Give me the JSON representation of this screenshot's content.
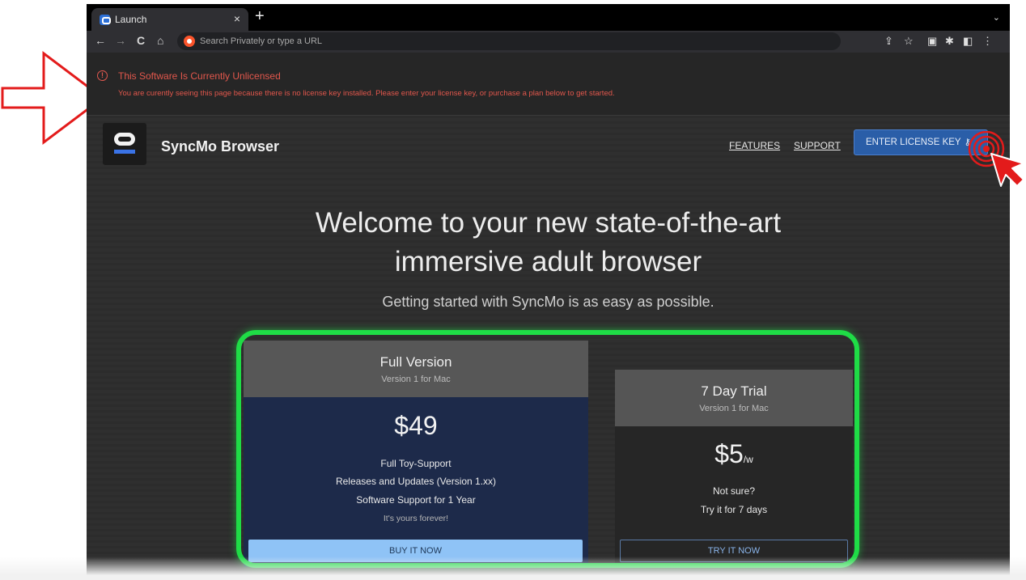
{
  "browser": {
    "tab_title": "Launch",
    "tab_close": "×",
    "new_tab": "+",
    "tab_menu": "⌄",
    "address_placeholder": "Search Privately or type a URL",
    "nav": {
      "back": "←",
      "forward": "→",
      "reload": "C",
      "home": "⌂"
    },
    "toolbar_icons": {
      "share": "⇪",
      "bookmark": "☆",
      "wallet": "▣",
      "extensions": "✱",
      "sidebar": "◧",
      "menu": "⋮"
    }
  },
  "banner": {
    "icon": "!",
    "title": "This Software Is Currently Unlicensed",
    "message": "You are curently seeing this page because there is no license key installed. Please enter your license key, or purchase a plan below to get started."
  },
  "header": {
    "brand": "SyncMo Browser",
    "nav": {
      "features": "FEATURES",
      "support": "SUPPORT"
    },
    "license_button": "ENTER LICENSE KEY",
    "license_icon": "⚷"
  },
  "hero": {
    "title_line1": "Welcome to your new state-of-the-art",
    "title_line2": "immersive adult browser",
    "subtitle": "Getting started with SyncMo is as easy as possible."
  },
  "plans": {
    "full": {
      "name": "Full Version",
      "subtitle": "Version 1 for Mac",
      "price": "$49",
      "features": [
        "Full Toy-Support",
        "Releases and Updates (Version 1.xx)",
        "Software Support for 1 Year"
      ],
      "note": "It's yours forever!",
      "button": "BUY IT NOW"
    },
    "trial": {
      "name": "7 Day Trial",
      "subtitle": "Version 1 for Mac",
      "price": "$5",
      "price_unit": "/w",
      "lines": [
        "Not sure?",
        "Try it for 7 days"
      ],
      "button": "TRY IT NOW"
    }
  },
  "colors": {
    "annotation_red": "#e31b1b",
    "highlight_green": "#1fdc46",
    "license_button": "#2a5ea8",
    "banner_text": "#e2574c"
  }
}
